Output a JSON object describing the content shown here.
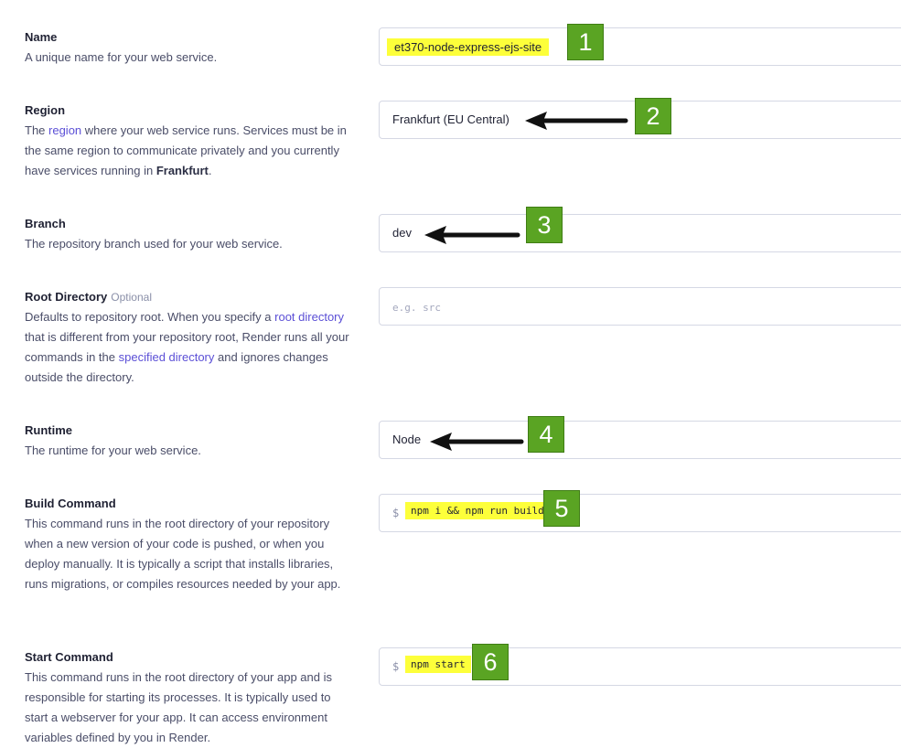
{
  "fields": {
    "name": {
      "title": "Name",
      "description": "A unique name for your web service.",
      "value": "et370-node-express-ejs-site"
    },
    "region": {
      "title": "Region",
      "desc_prefix": "The ",
      "desc_link": "region",
      "desc_mid": " where your web service runs. Services must be in the same region to communicate privately and you currently have services running in ",
      "desc_strong": "Frankfurt",
      "desc_suffix": ".",
      "value": "Frankfurt (EU Central)"
    },
    "branch": {
      "title": "Branch",
      "description": "The repository branch used for your web service.",
      "value": "dev"
    },
    "root_directory": {
      "title": "Root Directory",
      "optional": "Optional",
      "desc_1": "Defaults to repository root. When you specify a ",
      "desc_link_1": "root directory",
      "desc_2": " that is different from your repository root, Render runs all your commands in the ",
      "desc_link_2": "specified directory",
      "desc_3": " and ignores changes outside the directory.",
      "placeholder": "e.g. src"
    },
    "runtime": {
      "title": "Runtime",
      "description": "The runtime for your web service.",
      "value": "Node"
    },
    "build_command": {
      "title": "Build Command",
      "description": "This command runs in the root directory of your repository when a new version of your code is pushed, or when you deploy manually. It is typically a script that installs libraries, runs migrations, or compiles resources needed by your app.",
      "prompt": "$",
      "value": "npm i && npm run build"
    },
    "start_command": {
      "title": "Start Command",
      "description": "This command runs in the root directory of your app and is responsible for starting its processes. It is typically used to start a webserver for your app. It can access environment variables defined by you in Render.",
      "prompt": "$",
      "value": "npm start"
    }
  },
  "badges": [
    "1",
    "2",
    "3",
    "4",
    "5",
    "6"
  ],
  "colors": {
    "highlight": "#fdff3a",
    "badge": "#5aa423",
    "link": "#5b4fd6",
    "border": "#d5d8e4"
  }
}
